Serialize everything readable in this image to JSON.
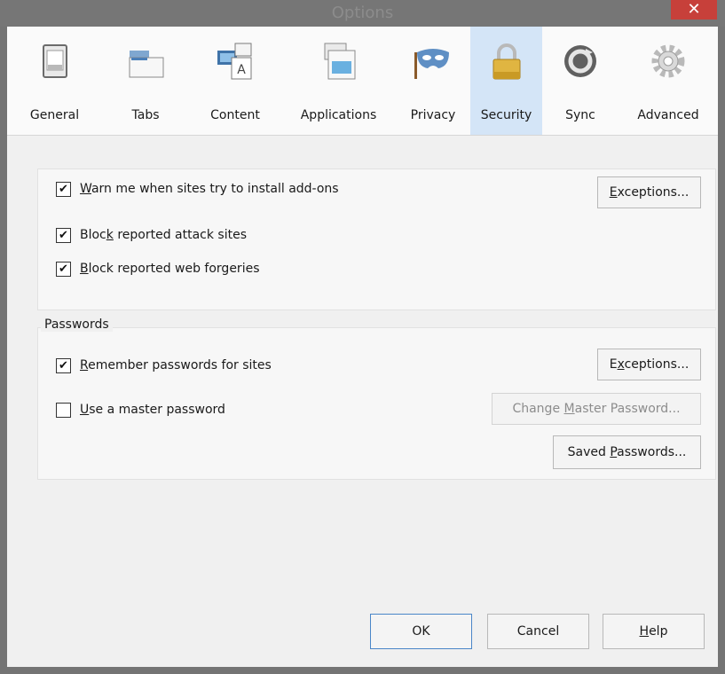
{
  "window": {
    "title": "Options",
    "close_label": "✕"
  },
  "tabs": [
    {
      "label": "General",
      "icon": "switch-icon"
    },
    {
      "label": "Tabs",
      "icon": "tabs-icon"
    },
    {
      "label": "Content",
      "icon": "content-icon"
    },
    {
      "label": "Applications",
      "icon": "applications-icon"
    },
    {
      "label": "Privacy",
      "icon": "mask-icon"
    },
    {
      "label": "Security",
      "icon": "lock-icon",
      "selected": true
    },
    {
      "label": "Sync",
      "icon": "sync-icon"
    },
    {
      "label": "Advanced",
      "icon": "gear-icon"
    }
  ],
  "security": {
    "warn_addons": {
      "pre": "",
      "ul": "W",
      "post": "arn me when sites try to install add-ons",
      "checked": true
    },
    "warn_exceptions": {
      "pre": "",
      "ul": "E",
      "post": "xceptions..."
    },
    "block_attack": {
      "pre": "Bloc",
      "ul": "k",
      "post": " reported attack sites",
      "checked": true
    },
    "block_forgeries": {
      "pre": "",
      "ul": "B",
      "post": "lock reported web forgeries",
      "checked": true
    }
  },
  "passwords": {
    "title": "Passwords",
    "remember": {
      "pre": "",
      "ul": "R",
      "post": "emember passwords for sites",
      "checked": true
    },
    "remember_exceptions": {
      "pre": "E",
      "ul": "x",
      "post": "ceptions..."
    },
    "master": {
      "pre": "",
      "ul": "U",
      "post": "se a master password",
      "checked": false
    },
    "change_master": {
      "pre": "Change ",
      "ul": "M",
      "post": "aster Password..."
    },
    "saved": {
      "pre": "Saved ",
      "ul": "P",
      "post": "asswords..."
    }
  },
  "footer": {
    "ok": "OK",
    "cancel": "Cancel",
    "help": {
      "pre": "",
      "ul": "H",
      "post": "elp"
    }
  }
}
